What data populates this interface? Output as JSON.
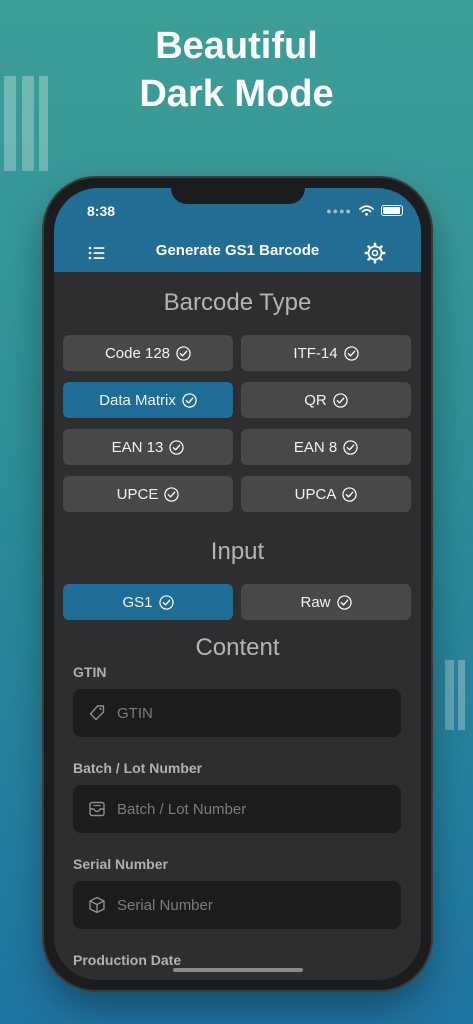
{
  "headline": {
    "line1": "Beautiful",
    "line2": "Dark Mode"
  },
  "status_bar": {
    "time": "8:38"
  },
  "nav": {
    "title": "Generate GS1 Barcode",
    "menu_icon": "list-icon",
    "settings_icon": "gear-icon"
  },
  "barcode_type": {
    "title": "Barcode Type",
    "options": [
      {
        "label": "Code 128",
        "selected": false
      },
      {
        "label": "ITF-14",
        "selected": false
      },
      {
        "label": "Data Matrix",
        "selected": true
      },
      {
        "label": "QR",
        "selected": false
      },
      {
        "label": "EAN 13",
        "selected": false
      },
      {
        "label": "EAN 8",
        "selected": false
      },
      {
        "label": "UPCE",
        "selected": false
      },
      {
        "label": "UPCA",
        "selected": false
      }
    ]
  },
  "input": {
    "title": "Input",
    "options": [
      {
        "label": "GS1",
        "selected": true
      },
      {
        "label": "Raw",
        "selected": false
      }
    ]
  },
  "content": {
    "title": "Content",
    "fields": [
      {
        "label": "GTIN",
        "placeholder": "GTIN",
        "value": "",
        "icon": "tag-icon"
      },
      {
        "label": "Batch / Lot Number",
        "placeholder": "Batch / Lot Number",
        "value": "",
        "icon": "tray-icon"
      },
      {
        "label": "Serial Number",
        "placeholder": "Serial Number",
        "value": "",
        "icon": "box-icon"
      },
      {
        "label": "Production Date",
        "placeholder": "",
        "value": "",
        "icon": ""
      }
    ]
  },
  "colors": {
    "accent": "#216d94",
    "selected_button": "#1e6d97",
    "button": "#48484a",
    "screen_bg": "#2e2e30",
    "field_bg": "#1c1c1e"
  }
}
